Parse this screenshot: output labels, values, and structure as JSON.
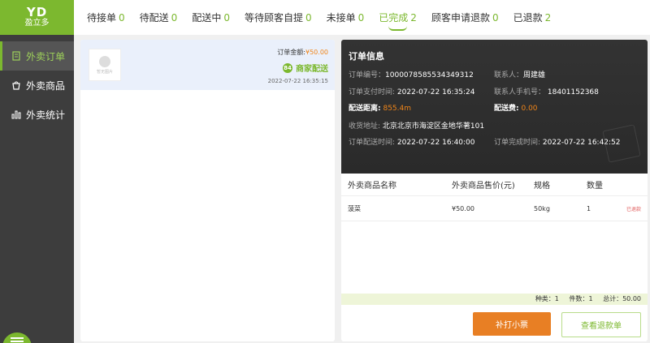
{
  "logo": {
    "line1": "YD",
    "line2": "盈立多"
  },
  "sidebar": {
    "items": [
      {
        "label": "外卖订单",
        "icon": "document-icon"
      },
      {
        "label": "外卖商品",
        "icon": "bag-icon"
      },
      {
        "label": "外卖统计",
        "icon": "bar-chart-icon"
      }
    ]
  },
  "tabs": [
    {
      "label": "待接单",
      "count": "0"
    },
    {
      "label": "待配送",
      "count": "0"
    },
    {
      "label": "配送中",
      "count": "0"
    },
    {
      "label": "等待顾客自提",
      "count": "0"
    },
    {
      "label": "未接单",
      "count": "0"
    },
    {
      "label": "已完成",
      "count": "2"
    },
    {
      "label": "顾客申请退款",
      "count": "0"
    },
    {
      "label": "已退款",
      "count": "2"
    }
  ],
  "order_card": {
    "thumb_text": "暂无图片",
    "amount_label": "订单金额:",
    "amount": "¥50.00",
    "badge_icon": "84",
    "badge": "商家配送",
    "time": "2022-07-22 16:35:15"
  },
  "detail": {
    "title": "订单信息",
    "order_no_label": "订单编号：",
    "order_no": "1000078585534349312",
    "contact_label": "联系人：",
    "contact": "周建雄",
    "pay_time_label": "订单支付时间:",
    "pay_time": "2022-07-22 16:35:24",
    "phone_label": "联系人手机号：",
    "phone": "18401152368",
    "distance_label": "配送距离:",
    "distance": "855.4m",
    "fee_label": "配送费:",
    "fee": "0.00",
    "address_label": "收货地址:",
    "address": "北京北京市海淀区金地华著101",
    "delivery_time_label": "订单配送时间:",
    "delivery_time": "2022-07-22 16:40:00",
    "complete_time_label": "订单完成时间:",
    "complete_time": "2022-07-22 16:42:52"
  },
  "table": {
    "headers": [
      "外卖商品名称",
      "外卖商品售价(元)",
      "规格",
      "数量"
    ],
    "rows": [
      {
        "name": "菠菜",
        "price": "¥50.00",
        "spec": "50kg",
        "qty": "1",
        "status": "已退款"
      }
    ]
  },
  "summary": {
    "kinds": "种类：1",
    "pieces": "件数：1",
    "total": "总计：50.00"
  },
  "buttons": {
    "reprint": "补打小票",
    "view_refund": "查看退款单"
  },
  "colors": {
    "accent": "#7cb82f",
    "orange": "#f08519",
    "sidebar": "#3d3d3d"
  }
}
